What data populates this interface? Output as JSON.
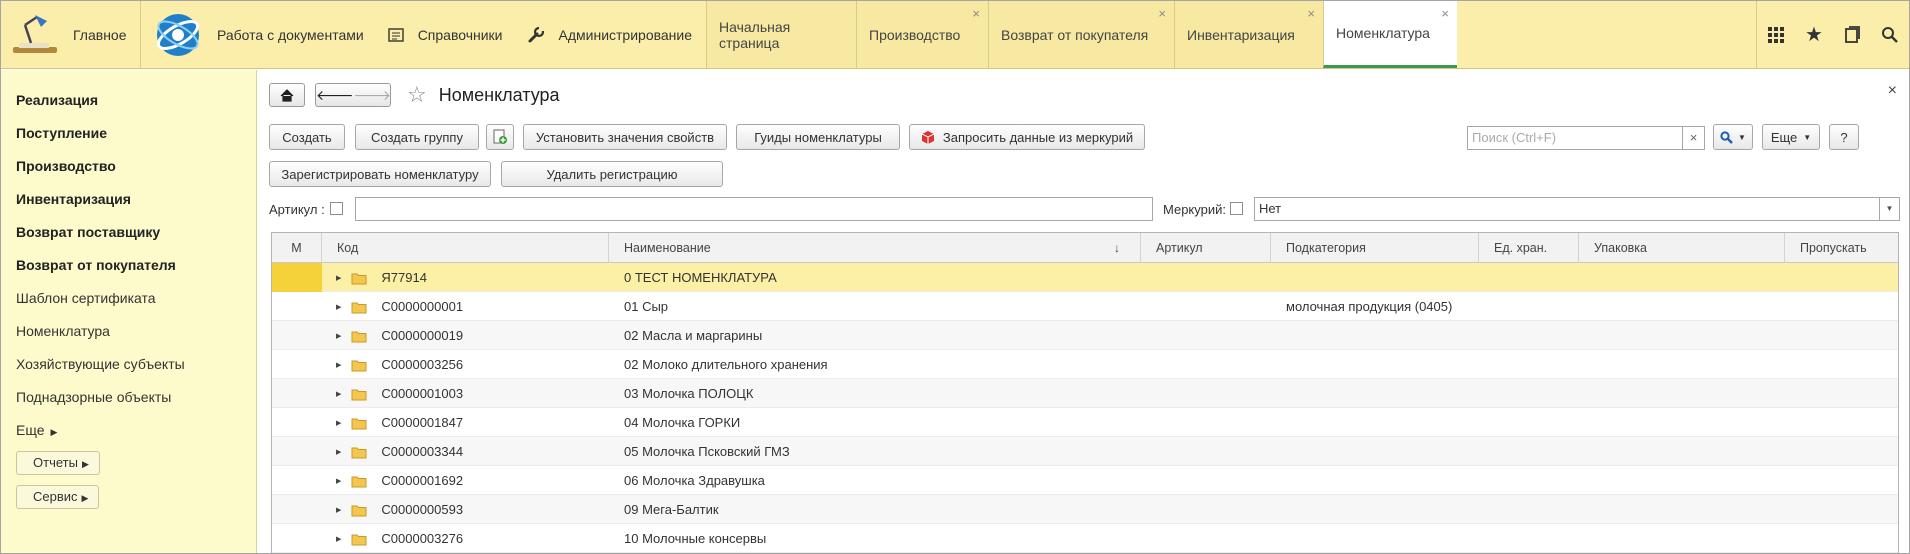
{
  "topbar": {
    "main_label": "Главное",
    "sections": [
      {
        "label": "Работа с документами",
        "icon": "documents-logo-icon"
      },
      {
        "label": "Справочники",
        "icon": "directory-icon"
      },
      {
        "label": "Администрирование",
        "icon": "wrench-icon"
      }
    ],
    "tabs": [
      {
        "label": "Начальная страница",
        "closable": false
      },
      {
        "label": "Производство",
        "closable": true
      },
      {
        "label": "Возврат от покупателя",
        "closable": true
      },
      {
        "label": "Инвентаризация",
        "closable": true
      },
      {
        "label": "Номенклатура",
        "closable": true,
        "active": true
      }
    ],
    "tools": [
      "apps-grid-icon",
      "star-icon",
      "history-icon",
      "search-icon"
    ]
  },
  "sidebar": {
    "items": [
      {
        "label": "Реализация",
        "bold": true
      },
      {
        "label": "Поступление",
        "bold": true
      },
      {
        "label": "Производство",
        "bold": true
      },
      {
        "label": "Инвентаризация",
        "bold": true
      },
      {
        "label": "Возврат поставщику",
        "bold": true
      },
      {
        "label": "Возврат от покупателя",
        "bold": true
      },
      {
        "label": "Шаблон сертификата",
        "bold": false
      },
      {
        "label": "Номенклатура",
        "bold": false
      },
      {
        "label": "Хозяйствующие субъекты",
        "bold": false
      },
      {
        "label": "Поднадзорные объекты",
        "bold": false
      }
    ],
    "more_label": "Еще",
    "reports_label": "Отчеты",
    "service_label": "Сервис"
  },
  "form": {
    "title": "Номенклатура",
    "buttons": {
      "create": "Создать",
      "create_group": "Создать группу",
      "set_props": "Установить значения свойств",
      "guids": "Гуиды номенклатуры",
      "request_mercury": "Запросить данные из меркурий",
      "register": "Зарегистрировать номенклатуру",
      "unregister": "Удалить регистрацию",
      "more": "Еще",
      "help": "?"
    },
    "search_placeholder": "Поиск (Ctrl+F)",
    "filter": {
      "article_label": "Артикул :",
      "mercury_label": "Меркурий:",
      "mercury_value": "Нет"
    }
  },
  "table": {
    "columns": [
      "М",
      "Код",
      "Наименование",
      "Артикул",
      "Подкатегория",
      "Ед. хран.",
      "Упаковка",
      "Пропускать"
    ],
    "rows": [
      {
        "code": "Я77914",
        "name": "0 ТЕСТ НОМЕНКЛАТУРА",
        "subcat": ""
      },
      {
        "code": "С0000000001",
        "name": "01 Сыр",
        "subcat": "молочная продукция (0405)"
      },
      {
        "code": "С0000000019",
        "name": "02 Масла и маргарины",
        "subcat": ""
      },
      {
        "code": "С0000003256",
        "name": "02 Молоко длительного хранения",
        "subcat": ""
      },
      {
        "code": "С0000001003",
        "name": "03 Молочка ПОЛОЦК",
        "subcat": ""
      },
      {
        "code": "С0000001847",
        "name": "04 Молочка ГОРКИ",
        "subcat": ""
      },
      {
        "code": "С0000003344",
        "name": "05 Молочка Псковский ГМЗ",
        "subcat": ""
      },
      {
        "code": "С0000001692",
        "name": "06 Молочка Здравушка",
        "subcat": ""
      },
      {
        "code": "С0000000593",
        "name": "09 Мега-Балтик",
        "subcat": ""
      },
      {
        "code": "С0000003276",
        "name": "10 Молочные консервы",
        "subcat": ""
      }
    ]
  }
}
